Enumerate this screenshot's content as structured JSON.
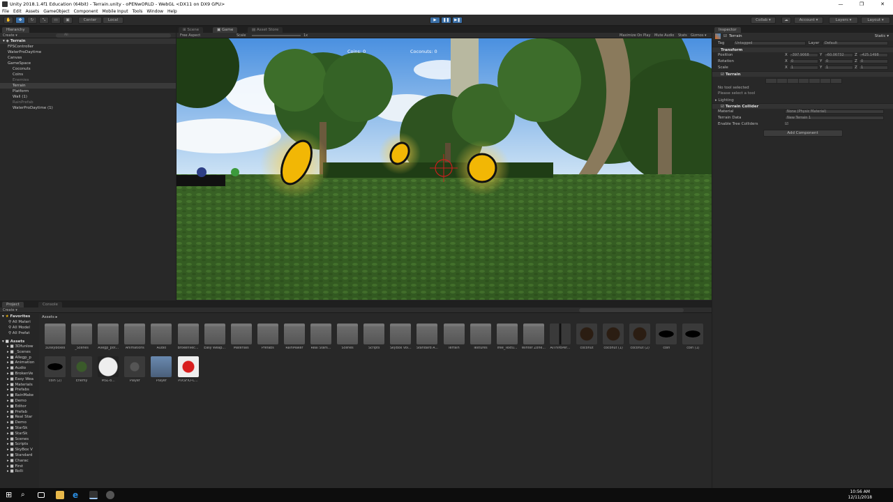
{
  "window": {
    "title": "Unity 2018.1.4f1 Education (64bit) - Terrain.unity - oPENwORLD - WebGL <DX11 on DX9 GPU>",
    "controls": [
      "—",
      "❐",
      "✕"
    ]
  },
  "menu": [
    "File",
    "Edit",
    "Assets",
    "GameObject",
    "Component",
    "Mobile Input",
    "Tools",
    "Window",
    "Help"
  ],
  "toolbar": {
    "pivot": "Center",
    "space": "Local",
    "collab": "Collab ▾",
    "account": "Account ▾",
    "layers": "Layers ▾",
    "layout": "Layout ▾"
  },
  "hierarchy": {
    "tab": "Hierarchy",
    "create": "Create ▾",
    "search_placeholder": "All",
    "scene": "Terrain",
    "items": [
      {
        "label": "FPSController",
        "indent": 1,
        "dim": false
      },
      {
        "label": "WaterProDaytime",
        "indent": 1,
        "dim": false
      },
      {
        "label": "Canvas",
        "indent": 1,
        "dim": false
      },
      {
        "label": "GameSpace",
        "indent": 1,
        "dim": false
      },
      {
        "label": "Coconuts",
        "indent": 2,
        "dim": false
      },
      {
        "label": "Coins",
        "indent": 2,
        "dim": false
      },
      {
        "label": "Enemies",
        "indent": 2,
        "dim": true
      },
      {
        "label": "Terrain",
        "indent": 2,
        "dim": false,
        "selected": true
      },
      {
        "label": "Platform",
        "indent": 2,
        "dim": false
      },
      {
        "label": "Wall (1)",
        "indent": 2,
        "dim": false
      },
      {
        "label": "RainPrefab",
        "indent": 2,
        "dim": true
      },
      {
        "label": "WaterProDaytime (1)",
        "indent": 2,
        "dim": false
      }
    ]
  },
  "center_tabs": {
    "scene": "Scene",
    "game": "Game",
    "store": "Asset Store"
  },
  "game_bar": {
    "aspect": "Free Aspect",
    "scale_label": "Scale",
    "scale_value": "1x",
    "maximize": "Maximize On Play",
    "mute": "Mute Audio",
    "stats": "Stats",
    "gizmos": "Gizmos ▾"
  },
  "hud": {
    "coins": "Coins: 0",
    "coconuts": "Coconuts: 0"
  },
  "inspector": {
    "tab": "Inspector",
    "object": "Terrain",
    "static": "Static ▾",
    "tag_label": "Tag",
    "tag_value": "Untagged",
    "layer_label": "Layer",
    "layer_value": "Default",
    "transform": {
      "title": "Transform",
      "position": [
        "-397.9068",
        "-60.06732",
        "-425.1498"
      ],
      "rotation": [
        "0",
        "0",
        "0"
      ],
      "scale": [
        "1",
        "1",
        "1"
      ],
      "labels": [
        "Position",
        "Rotation",
        "Scale"
      ],
      "axes": [
        "X",
        "Y",
        "Z"
      ]
    },
    "terrain": {
      "title": "Terrain",
      "msg1": "No tool selected",
      "msg2": "Please select a tool"
    },
    "lighting": "Lighting",
    "collider": {
      "title": "Terrain Collider",
      "material_label": "Material",
      "material_value": "None (Physic Material)",
      "data_label": "Terrain Data",
      "data_value": "New Terrain 1",
      "trees_label": "Enable Tree Colliders"
    },
    "add_component": "Add Component"
  },
  "project": {
    "tab": "Project",
    "console": "Console",
    "create": "Create ▾",
    "favorites": "Favorites",
    "fav_items": [
      "All Materi",
      "All Model",
      "All Prefat"
    ],
    "assets_root": "Assets",
    "tree": [
      "3Dfunlow",
      "_Scenes",
      "Allegp_p",
      "Animation",
      "Audio",
      "BrokenVe",
      "Easy Wea",
      "Materials",
      "Prefabs",
      "RainMake",
      "Demo",
      "Editor",
      "Prefab",
      "Real Star",
      "Demo",
      "StarSk",
      "StarSk",
      "Scenes",
      "Scripts",
      "SkyBox V",
      "Standard",
      "Charac",
      "First",
      "Rolli"
    ],
    "breadcrumb": "Assets ▸",
    "assets": [
      {
        "label": "3Dskyboxes",
        "kind": "folder"
      },
      {
        "label": "_Scenes",
        "kind": "folder"
      },
      {
        "label": "Allegp_pot...",
        "kind": "folder"
      },
      {
        "label": "Animations",
        "kind": "folder"
      },
      {
        "label": "Audio",
        "kind": "folder"
      },
      {
        "label": "BrokenVec...",
        "kind": "folder"
      },
      {
        "label": "Easy Weap...",
        "kind": "folder"
      },
      {
        "label": "Materials",
        "kind": "folder"
      },
      {
        "label": "Prefabs",
        "kind": "folder"
      },
      {
        "label": "RainMaker",
        "kind": "folder"
      },
      {
        "label": "Real Stars...",
        "kind": "folder"
      },
      {
        "label": "Scenes",
        "kind": "folder"
      },
      {
        "label": "Scripts",
        "kind": "folder"
      },
      {
        "label": "SkyBox Vol...",
        "kind": "folder"
      },
      {
        "label": "Standard A...",
        "kind": "folder"
      },
      {
        "label": "Terrain",
        "kind": "folder"
      },
      {
        "label": "Textures",
        "kind": "folder"
      },
      {
        "label": "Tree_Textu...",
        "kind": "folder"
      },
      {
        "label": "Winter Zone...",
        "kind": "folder"
      },
      {
        "label": "AIThirdPer...",
        "kind": "model"
      },
      {
        "label": "coconut",
        "kind": "sphere"
      },
      {
        "label": "coconut (1)",
        "kind": "sphere"
      },
      {
        "label": "coconut (2)",
        "kind": "sphere"
      },
      {
        "label": "coin",
        "kind": "coin"
      },
      {
        "label": "coin (1)",
        "kind": "coin"
      },
      {
        "label": "coin (2)",
        "kind": "coin"
      },
      {
        "label": "Enemy",
        "kind": "enemy"
      },
      {
        "label": "MSL-8...",
        "kind": "target"
      },
      {
        "label": "Player",
        "kind": "player"
      },
      {
        "label": "Player",
        "kind": "player2"
      },
      {
        "label": "PIXSFIO-C...",
        "kind": "red"
      }
    ]
  },
  "taskbar": {
    "time": "10:56 AM",
    "date": "12/11/2018"
  },
  "colors": {
    "accent": "#3a6ea5",
    "coin": "#f2b705",
    "panel": "#282828"
  }
}
